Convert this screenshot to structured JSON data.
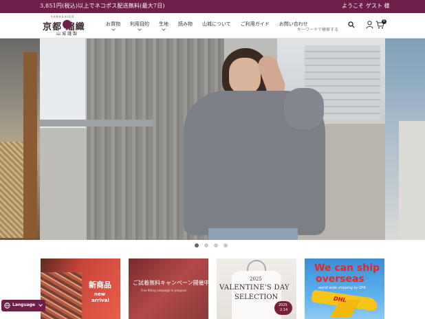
{
  "topbar": {
    "promo": "3,851円(税込)以上でネコポス配送無料(最大7日)",
    "welcome": "ようこそ",
    "guest": "ゲスト 様"
  },
  "logo": {
    "tiny": "YAMASHIRO",
    "main": "京都 縮織",
    "sub": "山城謹製"
  },
  "nav": {
    "items": [
      {
        "label": "お買物",
        "has_dropdown": true
      },
      {
        "label": "利用目的",
        "has_dropdown": true
      },
      {
        "label": "生地",
        "has_dropdown": true
      },
      {
        "label": "読み物",
        "has_dropdown": false
      },
      {
        "label": "山城について",
        "has_dropdown": false
      },
      {
        "label": "ご利用ガイド",
        "has_dropdown": false
      },
      {
        "label": "お問い合わせ",
        "has_dropdown": false
      }
    ]
  },
  "search": {
    "placeholder": "キーワードで検索する",
    "icon": "search-icon"
  },
  "header_icons": {
    "user": "user-icon",
    "cart": "cart-icon",
    "cart_count": "0"
  },
  "hero": {
    "slide_count": 4,
    "active_index": 0
  },
  "banners": [
    {
      "title": "新商品",
      "line2": "new",
      "line3": "arrival"
    },
    {
      "title": "ご試着無料キャンペーン開催中",
      "subtitle": "Free fitting campaign in progress"
    },
    {
      "year": "2025",
      "title": "VALENTINE'S DAY",
      "subtitle": "SELECTION",
      "heart_year": "2025",
      "heart_date": "2.14"
    },
    {
      "line1": "We can ship",
      "line2": "overseas",
      "line3": "world wide shipping by DHL",
      "badge": "DHL"
    }
  ],
  "language": {
    "label": "Language",
    "icon": "globe-icon"
  },
  "colors": {
    "brand": "#6e1e48",
    "header_bg": "#ffffff",
    "dot_active": "#666666",
    "dot_inactive": "#c9c9c9"
  }
}
